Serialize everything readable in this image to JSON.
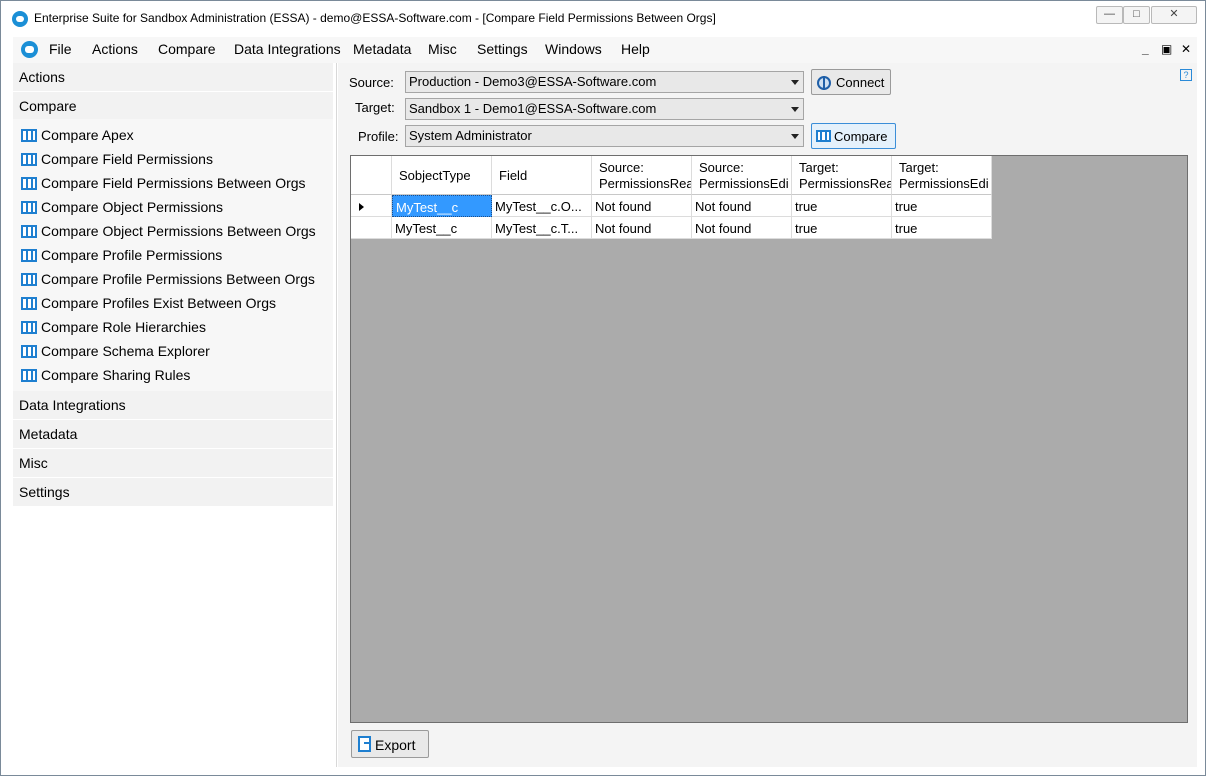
{
  "window": {
    "title": "Enterprise Suite for Sandbox Administration (ESSA) - demo@ESSA-Software.com - [Compare Field Permissions Between Orgs]",
    "controls": {
      "minimize": "—",
      "maximize": "□",
      "close": "✕"
    }
  },
  "menu": {
    "items": [
      "File",
      "Actions",
      "Compare",
      "Data Integrations",
      "Metadata",
      "Misc",
      "Settings",
      "Windows",
      "Help"
    ],
    "mdi_controls": {
      "minimize": "_",
      "restore": "▣",
      "close": "✕"
    }
  },
  "left_panel": {
    "sections": {
      "actions": "Actions",
      "compare": "Compare",
      "data_integrations": "Data Integrations",
      "metadata": "Metadata",
      "misc": "Misc",
      "settings": "Settings"
    },
    "compare_items": [
      "Compare Apex",
      "Compare Field Permissions",
      "Compare Field Permissions Between Orgs",
      "Compare Object Permissions",
      "Compare Object Permissions Between Orgs",
      "Compare Profile Permissions",
      "Compare Profile Permissions Between Orgs",
      "Compare Profiles Exist Between Orgs",
      "Compare Role Hierarchies",
      "Compare Schema Explorer",
      "Compare Sharing Rules"
    ]
  },
  "form": {
    "source_label": "Source:",
    "source_value": "Production - Demo3@ESSA-Software.com",
    "target_label": "Target:",
    "target_value": "Sandbox 1 - Demo1@ESSA-Software.com",
    "profile_label": "Profile:",
    "profile_value": "System Administrator",
    "connect_label": "Connect",
    "compare_label": "Compare",
    "help": "?"
  },
  "grid": {
    "columns": [
      {
        "line1": "SobjectType",
        "line2": ""
      },
      {
        "line1": "Field",
        "line2": ""
      },
      {
        "line1": "Source:",
        "line2": "PermissionsRea"
      },
      {
        "line1": "Source:",
        "line2": "PermissionsEdi"
      },
      {
        "line1": "Target:",
        "line2": "PermissionsRea"
      },
      {
        "line1": "Target:",
        "line2": "PermissionsEdi"
      }
    ],
    "rows": [
      [
        "MyTest__c",
        "MyTest__c.O...",
        "Not found",
        "Not found",
        "true",
        "true"
      ],
      [
        "MyTest__c",
        "MyTest__c.T...",
        "Not found",
        "Not found",
        "true",
        "true"
      ]
    ]
  },
  "export_label": "Export"
}
